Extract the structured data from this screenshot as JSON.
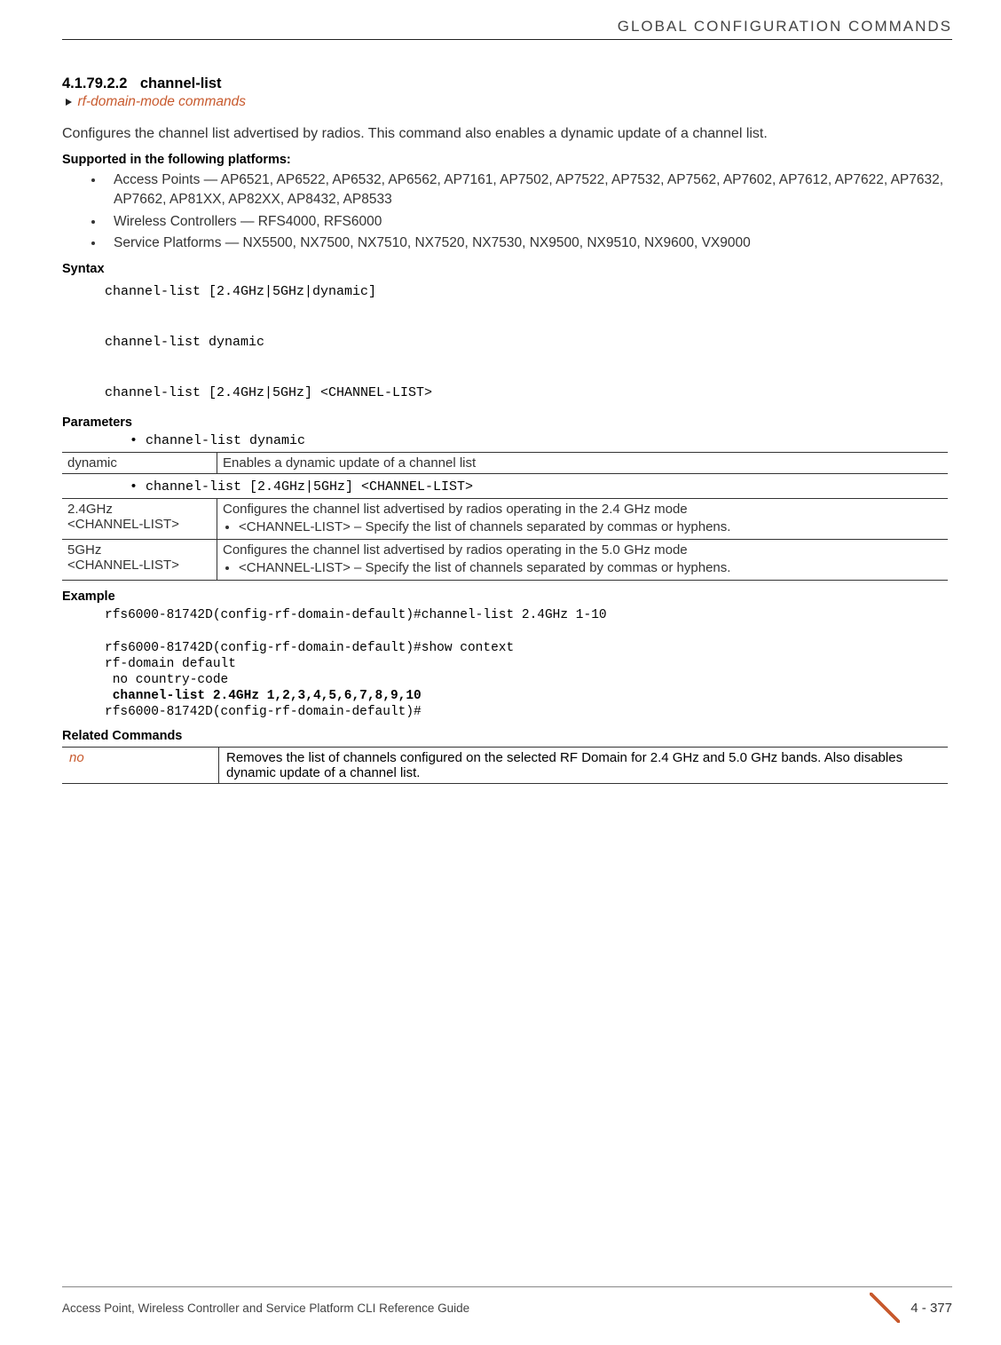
{
  "header": {
    "category": "GLOBAL CONFIGURATION COMMANDS"
  },
  "section": {
    "number": "4.1.79.2.2",
    "title": "channel-list",
    "breadcrumb": "rf-domain-mode commands"
  },
  "intro": "Configures the channel list advertised by radios. This command also enables a dynamic update of a channel list.",
  "supported": {
    "heading": "Supported in the following platforms:",
    "items": [
      "Access Points — AP6521, AP6522, AP6532, AP6562, AP7161, AP7502, AP7522, AP7532, AP7562, AP7602, AP7612, AP7622, AP7632, AP7662, AP81XX, AP82XX, AP8432, AP8533",
      "Wireless Controllers — RFS4000, RFS6000",
      "Service Platforms — NX5500, NX7500, NX7510, NX7520, NX7530, NX9500, NX9510, NX9600, VX9000"
    ]
  },
  "syntax": {
    "heading": "Syntax",
    "lines": [
      "channel-list [2.4GHz|5GHz|dynamic]",
      "channel-list dynamic",
      "channel-list [2.4GHz|5GHz] <CHANNEL-LIST>"
    ]
  },
  "parameters": {
    "heading": "Parameters",
    "intro1": "• channel-list dynamic",
    "table1": {
      "col1": "dynamic",
      "col2": "Enables a dynamic update of a channel list"
    },
    "intro2": "• channel-list [2.4GHz|5GHz] <CHANNEL-LIST>",
    "table2": [
      {
        "col1a": "2.4GHz",
        "col1b": "<CHANNEL-LIST>",
        "desc": "Configures the channel list advertised by radios operating in the 2.4 GHz mode",
        "sub": "<CHANNEL-LIST> – Specify the list of channels separated by commas or hyphens."
      },
      {
        "col1a": "5GHz",
        "col1b": "<CHANNEL-LIST>",
        "desc": "Configures the channel list advertised by radios operating in the 5.0 GHz mode",
        "sub": "<CHANNEL-LIST> – Specify the list of channels separated by commas or hyphens."
      }
    ]
  },
  "example": {
    "heading": "Example",
    "line1": "rfs6000-81742D(config-rf-domain-default)#channel-list 2.4GHz 1-10",
    "line2": "rfs6000-81742D(config-rf-domain-default)#show context",
    "line3": "rf-domain default",
    "line4": " no country-code",
    "line5": " channel-list 2.4GHz 1,2,3,4,5,6,7,8,9,10",
    "line6": "rfs6000-81742D(config-rf-domain-default)#"
  },
  "related": {
    "heading": "Related Commands",
    "col1": "no",
    "col2": "Removes the list of channels configured on the selected RF Domain for 2.4 GHz and 5.0 GHz bands. Also disables dynamic update of a channel list."
  },
  "footer": {
    "left": "Access Point, Wireless Controller and Service Platform CLI Reference Guide",
    "page": "4 - 377"
  }
}
